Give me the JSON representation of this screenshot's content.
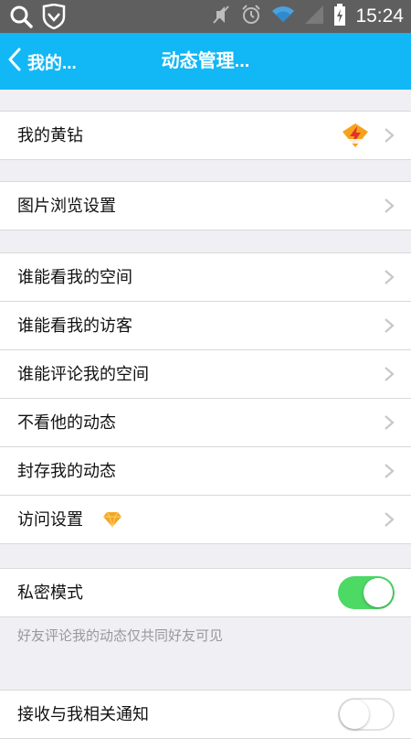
{
  "status_bar": {
    "time": "15:24",
    "icons": [
      "search-icon",
      "shield-icon",
      "mute-icon",
      "alarm-icon",
      "wifi-icon",
      "signal-icon",
      "battery-charging-icon"
    ]
  },
  "nav": {
    "back_label": "我的...",
    "title": "动态管理..."
  },
  "sections": {
    "vip": {
      "label": "我的黄钻",
      "badge": "lightning-badge-icon"
    },
    "photo": {
      "label": "图片浏览设置"
    },
    "privacy": [
      {
        "label": "谁能看我的空间"
      },
      {
        "label": "谁能看我的访客"
      },
      {
        "label": "谁能评论我的空间"
      },
      {
        "label": "不看他的动态"
      },
      {
        "label": "封存我的动态"
      },
      {
        "label": "访问设置",
        "badge": "diamond-icon"
      }
    ],
    "private_mode": {
      "label": "私密模式",
      "on": true,
      "hint": "好友评论我的动态仅共同好友可见"
    },
    "notify": {
      "label": "接收与我相关通知",
      "on": false
    }
  },
  "colors": {
    "nav_bg": "#12b7f5",
    "toggle_on": "#4cd964",
    "page_bg": "#efeff4"
  }
}
